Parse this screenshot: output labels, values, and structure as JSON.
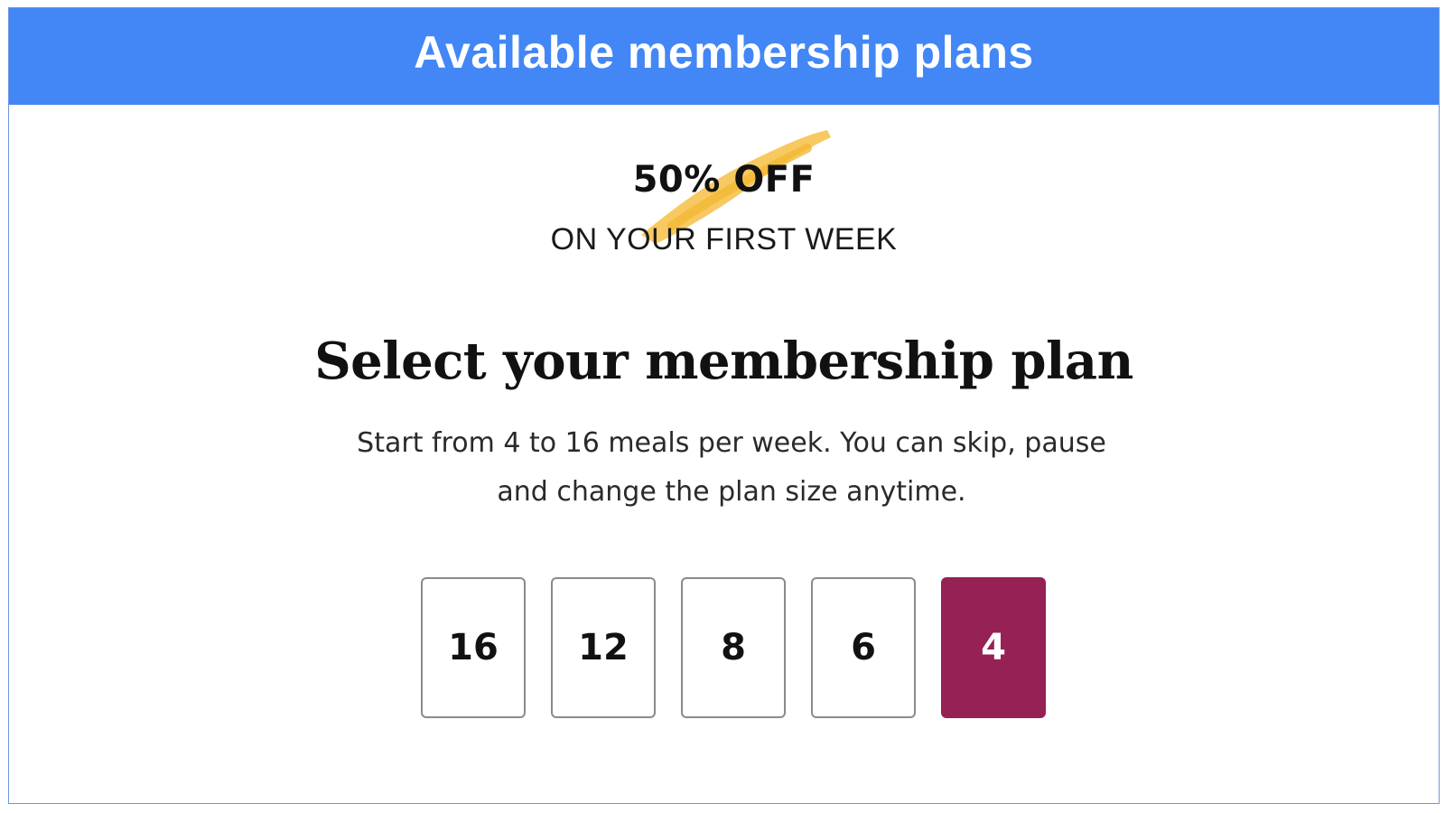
{
  "header": {
    "title": "Available membership plans",
    "background_color": "#4287f5"
  },
  "promo": {
    "discount": "50% OFF",
    "detail": "ON YOUR FIRST WEEK",
    "brush_color": "#f6c453"
  },
  "plan_selector": {
    "title": "Select your membership plan",
    "description_line1": "Start from 4 to 16 meals per week. You can skip, pause",
    "description_line2": "and change the plan size anytime.",
    "options": [
      "16",
      "12",
      "8",
      "6",
      "4"
    ],
    "selected": "4",
    "selected_color": "#962155"
  }
}
